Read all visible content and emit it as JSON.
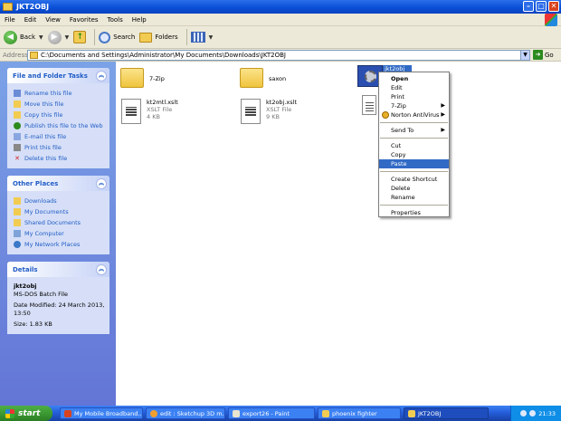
{
  "window": {
    "title": "JKT2OBJ"
  },
  "menu": [
    "File",
    "Edit",
    "View",
    "Favorites",
    "Tools",
    "Help"
  ],
  "toolbar": {
    "back_label": "Back",
    "search_label": "Search",
    "folders_label": "Folders"
  },
  "address": {
    "label": "Address",
    "path": "C:\\Documents and Settings\\Administrator\\My Documents\\Downloads\\JKT2OBJ",
    "go_label": "Go"
  },
  "file_tasks": {
    "title": "File and Folder Tasks",
    "items": [
      "Rename this file",
      "Move this file",
      "Copy this file",
      "Publish this file to the Web",
      "E-mail this file",
      "Print this file",
      "Delete this file"
    ]
  },
  "other_places": {
    "title": "Other Places",
    "items": [
      "Downloads",
      "My Documents",
      "Shared Documents",
      "My Computer",
      "My Network Places"
    ]
  },
  "details": {
    "title": "Details",
    "name": "jkt2obj",
    "type": "MS-DOS Batch File",
    "modified": "Date Modified: 24 March 2013, 13:50",
    "size": "Size: 1.83 KB"
  },
  "files": [
    {
      "name": "7-Zip",
      "kind": "folder"
    },
    {
      "name": "saxon",
      "kind": "folder"
    },
    {
      "name": "jkt2obj",
      "kind": "batch"
    },
    {
      "name": "kt2mtl.xslt",
      "type": "XSLT File",
      "size": "4 KB"
    },
    {
      "name": "kt2obj.xslt",
      "type": "XSLT File",
      "size": "9 KB"
    }
  ],
  "context_menu": {
    "items": [
      "Open",
      "Edit",
      "Print",
      "7-Zip",
      "Norton AntiVirus",
      "Send To",
      "Cut",
      "Copy",
      "Paste",
      "Create Shortcut",
      "Delete",
      "Rename",
      "Properties"
    ],
    "highlighted": "Paste"
  },
  "taskbar": {
    "start_label": "start",
    "buttons": [
      "My Mobile Broadband...",
      "edit : Sketchup 3D m...",
      "export26 - Paint",
      "phoenix fighter",
      "JKT2OBJ"
    ],
    "clock": "21:33"
  },
  "colors": {
    "title_blue": "#0a4fd6",
    "task_pane": "#6375d6",
    "selection": "#316ac5",
    "start_green": "#3c9a33"
  }
}
